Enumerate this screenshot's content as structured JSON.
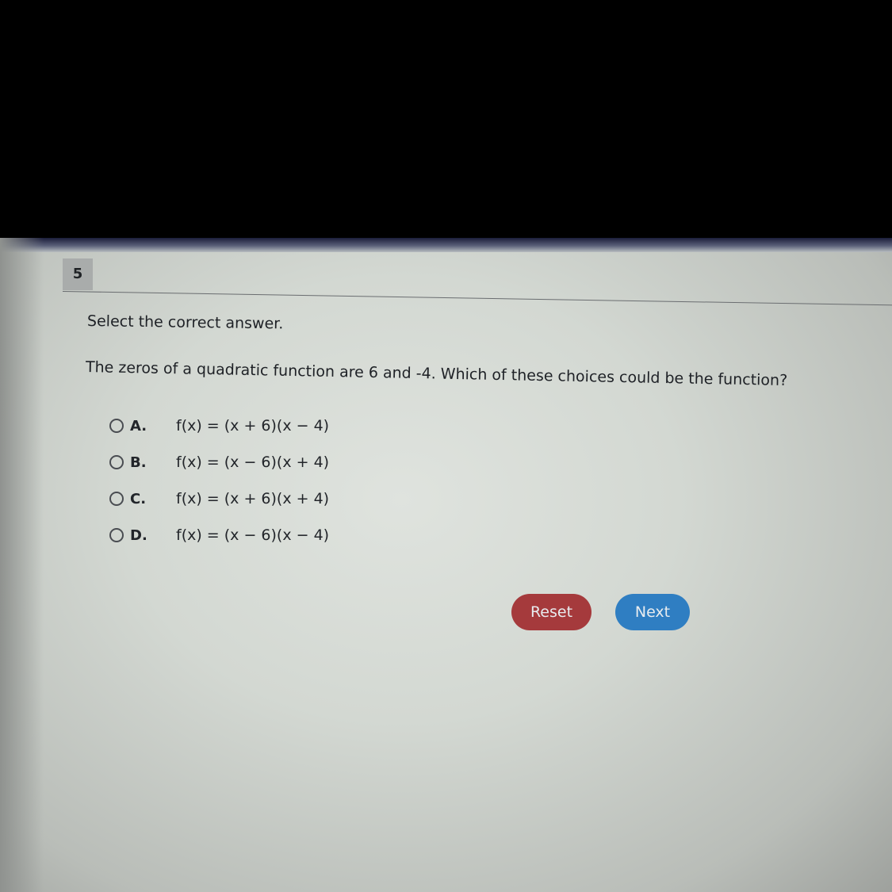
{
  "question": {
    "number": "5",
    "instruction": "Select the correct answer.",
    "prompt": "The zeros of a quadratic function are 6 and -4. Which of these choices could be the function?"
  },
  "choices": [
    {
      "letter": "A.",
      "formula": "f(x) = (x + 6)(x − 4)",
      "selected": false
    },
    {
      "letter": "B.",
      "formula": "f(x) = (x − 6)(x + 4)",
      "selected": false
    },
    {
      "letter": "C.",
      "formula": "f(x) = (x + 6)(x + 4)",
      "selected": false
    },
    {
      "letter": "D.",
      "formula": "f(x) = (x − 6)(x − 4)",
      "selected": false
    }
  ],
  "buttons": {
    "reset_label": "Reset",
    "next_label": "Next"
  },
  "colors": {
    "reset": "#a53a3c",
    "next": "#2f7ec2"
  }
}
